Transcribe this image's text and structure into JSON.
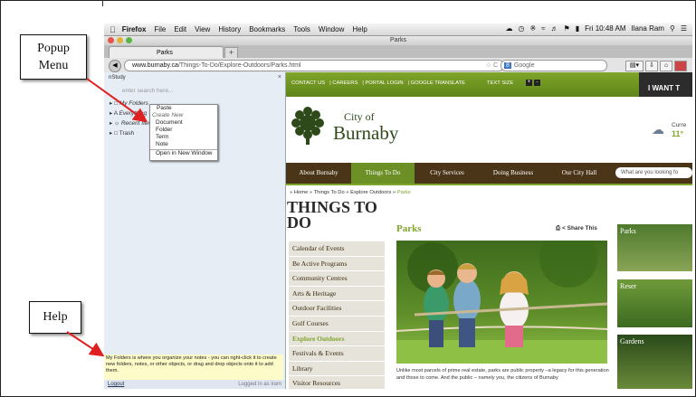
{
  "annotations": {
    "popup_label": "Popup\nMenu",
    "help_label": "Help"
  },
  "menubar": {
    "app": "Firefox",
    "items": [
      "File",
      "Edit",
      "View",
      "History",
      "Bookmarks",
      "Tools",
      "Window",
      "Help"
    ],
    "clock": "Fri 10:48 AM",
    "user": "Ilana Ram"
  },
  "window": {
    "title": "Parks",
    "tab_label": "Parks",
    "new_tab": "+"
  },
  "navbar": {
    "url_domain": "www.burnaby.ca",
    "url_path": "/Things-To-Do/Explore-Outdoors/Parks.html",
    "search_placeholder": "Google"
  },
  "nstudy": {
    "header": "nStudy",
    "close": "×",
    "search_placeholder": "enter search here...",
    "tree": [
      "My Folders",
      "Everything",
      "Recent Items",
      "Trash"
    ],
    "help_text": "My Folders is where you organize your notes - you can right-click it to create new folders, notes, or other objects, or drag and drop objects onto it to add them.",
    "logout": "Logout",
    "logged_in_as": "Logged in as iram"
  },
  "context_menu": {
    "paste": "Paste",
    "create_new": "Create New",
    "items": [
      "Document",
      "Folder",
      "Term",
      "Note"
    ],
    "open_new_window": "Open in New Window"
  },
  "site": {
    "top_links": [
      "CONTACT US",
      "CAREERS",
      "PORTAL LOGIN",
      "GOOGLE TRANSLATE"
    ],
    "text_size": "TEXT SIZE",
    "i_want": "I WANT T",
    "logo_city": "City of",
    "logo_name": "Burnaby",
    "weather_label": "Curre",
    "weather_temp": "11°",
    "nav": [
      "About Burnaby",
      "Things To Do",
      "City Services",
      "Doing Business",
      "Our City Hall"
    ],
    "nav_search": "What are you looking fo",
    "breadcrumbs": "» Home » Things To Do » Explore Outdoors »",
    "breadcrumb_current": "Parks",
    "section_title": "THINGS TO DO",
    "left_nav": [
      "Calendar of Events",
      "Be Active Programs",
      "Community Centres",
      "Arts & Heritage",
      "Outdoor Facilities",
      "Golf Courses",
      "Explore Outdoors",
      "Festivals & Events",
      "Library",
      "Visitor Resources"
    ],
    "page_heading": "Parks",
    "share": "Share This",
    "caption": "Unlike most parcels of prime real estate, parks are public property –a legacy for this generation and those to come. And the public – namely you, the citizens of Burnaby",
    "thumbs": [
      "Parks",
      "Reser",
      "Gardens"
    ]
  }
}
